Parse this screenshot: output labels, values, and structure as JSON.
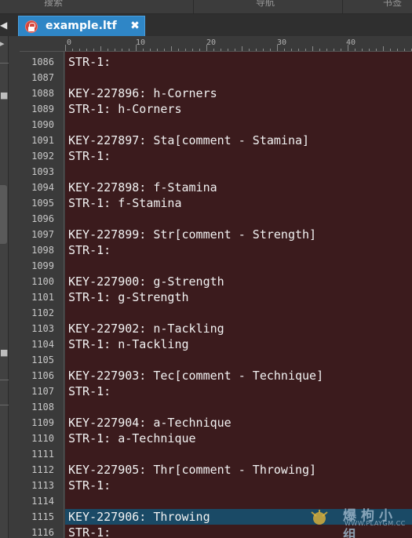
{
  "header": {
    "panels": [
      "搜索",
      "导航",
      "书签"
    ]
  },
  "tab": {
    "title": "example.ltf",
    "lock_icon": "lock-icon",
    "close_icon": "close-icon",
    "active_color": "#2f86c6"
  },
  "ruler": {
    "labels": [
      "0",
      "10",
      "20",
      "30",
      "40"
    ]
  },
  "editor": {
    "background": "#3b1b1d",
    "highlight_color": "#1a4a66",
    "lines": [
      {
        "num": "1086",
        "text": "STR-1:"
      },
      {
        "num": "1087",
        "text": ""
      },
      {
        "num": "1088",
        "text": "KEY-227896: h-Corners"
      },
      {
        "num": "1089",
        "text": "STR-1: h-Corners"
      },
      {
        "num": "1090",
        "text": ""
      },
      {
        "num": "1091",
        "text": "KEY-227897: Sta[comment - Stamina]"
      },
      {
        "num": "1092",
        "text": "STR-1:"
      },
      {
        "num": "1093",
        "text": ""
      },
      {
        "num": "1094",
        "text": "KEY-227898: f-Stamina"
      },
      {
        "num": "1095",
        "text": "STR-1: f-Stamina"
      },
      {
        "num": "1096",
        "text": ""
      },
      {
        "num": "1097",
        "text": "KEY-227899: Str[comment - Strength]"
      },
      {
        "num": "1098",
        "text": "STR-1:"
      },
      {
        "num": "1099",
        "text": ""
      },
      {
        "num": "1100",
        "text": "KEY-227900: g-Strength"
      },
      {
        "num": "1101",
        "text": "STR-1: g-Strength"
      },
      {
        "num": "1102",
        "text": ""
      },
      {
        "num": "1103",
        "text": "KEY-227902: n-Tackling"
      },
      {
        "num": "1104",
        "text": "STR-1: n-Tackling"
      },
      {
        "num": "1105",
        "text": ""
      },
      {
        "num": "1106",
        "text": "KEY-227903: Tec[comment - Technique]"
      },
      {
        "num": "1107",
        "text": "STR-1:"
      },
      {
        "num": "1108",
        "text": ""
      },
      {
        "num": "1109",
        "text": "KEY-227904: a-Technique"
      },
      {
        "num": "1110",
        "text": "STR-1: a-Technique"
      },
      {
        "num": "1111",
        "text": ""
      },
      {
        "num": "1112",
        "text": "KEY-227905: Thr[comment - Throwing]"
      },
      {
        "num": "1113",
        "text": "STR-1:"
      },
      {
        "num": "1114",
        "text": ""
      },
      {
        "num": "1115",
        "text": "KEY-227906: Throwing",
        "highlighted": true
      },
      {
        "num": "1116",
        "text": "STR-1:"
      }
    ]
  },
  "watermark": {
    "text": "爆枸小组",
    "url": "WWW.PLAYGM.CC"
  }
}
